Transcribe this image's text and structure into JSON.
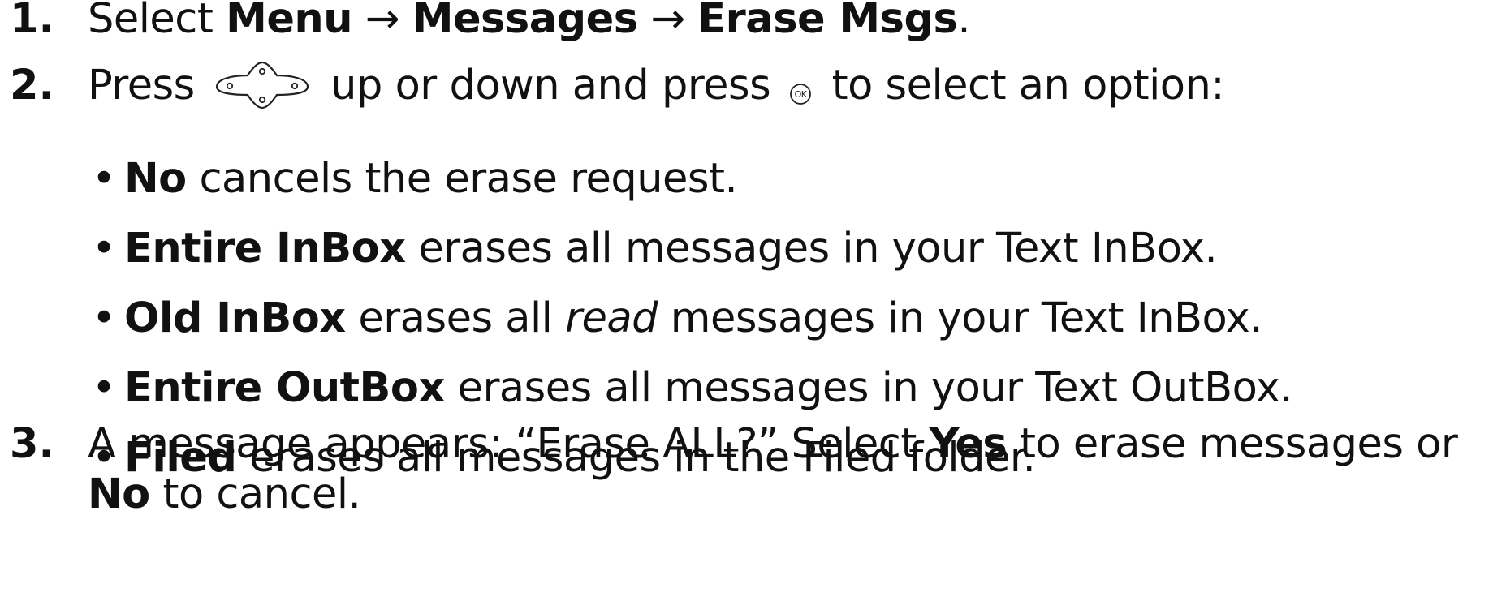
{
  "steps": [
    {
      "number": "1.",
      "select": "Select",
      "menu": "Menu",
      "arrow1": "→",
      "messages": "Messages",
      "arrow2": "→",
      "erase_msgs": "Erase Msgs",
      "period": "."
    },
    {
      "number": "2.",
      "press": "Press",
      "up_down": "up or down and press",
      "to_select": "to select an option:",
      "nav_icon": "navigation-key-icon",
      "ok_icon": "ok-key-icon"
    },
    {
      "number": "3.",
      "text1": "A message appears: “Erase ALL?” Select",
      "yes": "Yes",
      "text2": "to erase messages or",
      "no": "No",
      "text3": "to cancel."
    }
  ],
  "options": [
    {
      "label": "No",
      "text": "cancels the erase request."
    },
    {
      "label": "Entire InBox",
      "text": "erases all messages in your Text InBox."
    },
    {
      "label": "Old InBox",
      "text_before": "erases all",
      "emphasis": "read",
      "text_after": "messages in your Text InBox."
    },
    {
      "label": "Entire OutBox",
      "text": "erases all messages in your Text OutBox."
    },
    {
      "label": "Filed",
      "text": "erases all messages in the Filed folder."
    }
  ]
}
